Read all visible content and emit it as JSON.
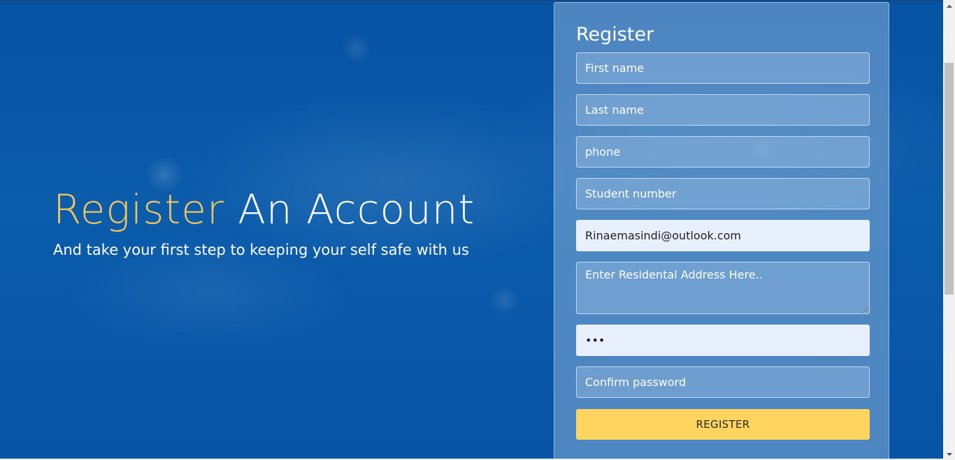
{
  "hero": {
    "headline_accent": "Register",
    "headline_rest": " An Account",
    "subheadline": "And take your first step to keeping your self safe with us"
  },
  "form": {
    "title": "Register",
    "first_name": {
      "placeholder": "First name",
      "value": ""
    },
    "last_name": {
      "placeholder": "Last name",
      "value": ""
    },
    "phone": {
      "placeholder": "phone",
      "value": ""
    },
    "student_number": {
      "placeholder": "Student number",
      "value": ""
    },
    "email": {
      "placeholder": "",
      "value": "Rinaemasindi@outlook.com"
    },
    "address": {
      "placeholder": "Enter Residental Address Here..",
      "value": ""
    },
    "password": {
      "placeholder": "",
      "value": "•••"
    },
    "confirm_password": {
      "placeholder": "Confirm password",
      "value": ""
    },
    "submit_label": "REGISTER"
  },
  "colors": {
    "background": "#0652a3",
    "accent_text": "#f2c45a",
    "button": "#ffd55f",
    "autofill": "#e8f0fe"
  }
}
